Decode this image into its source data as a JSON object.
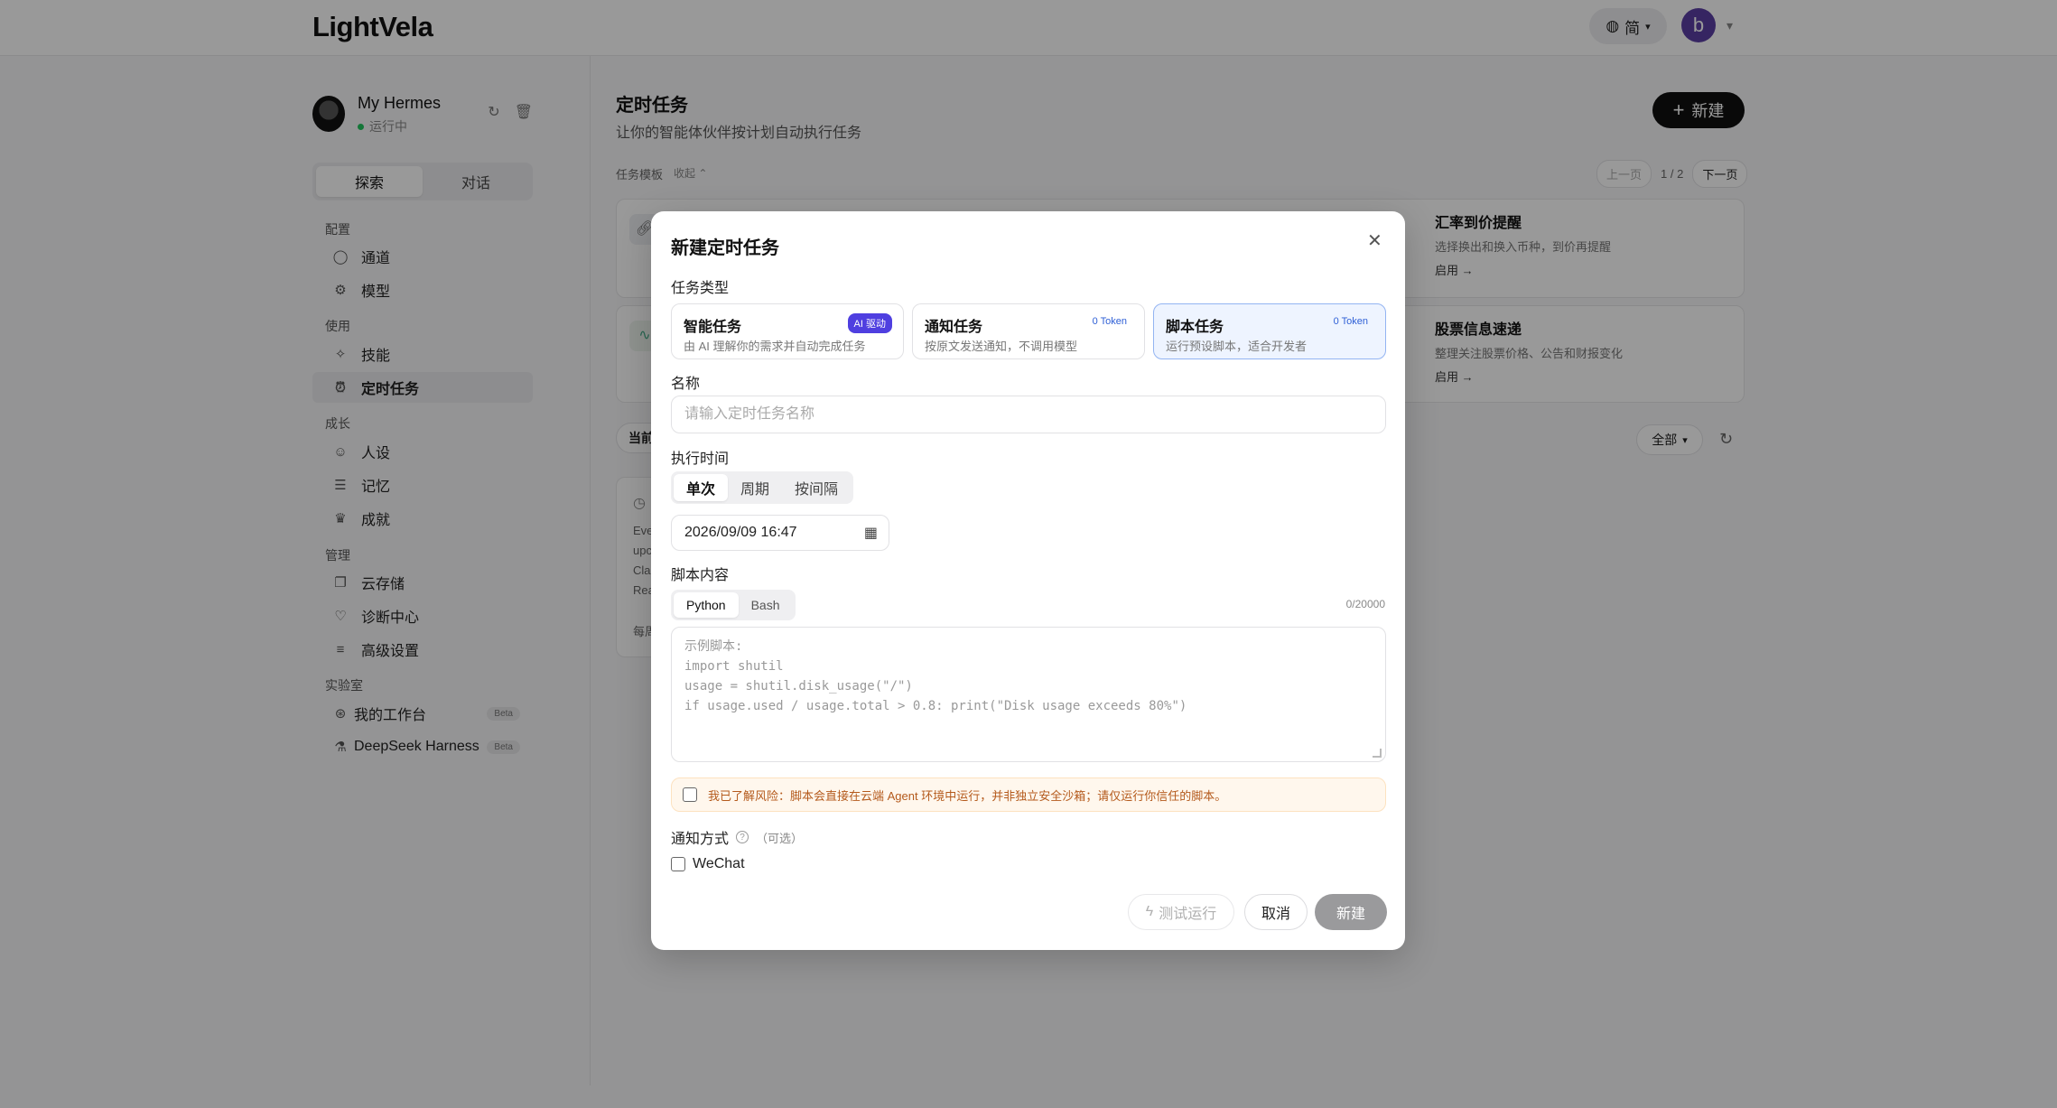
{
  "app": {
    "logo": "LightVela"
  },
  "header": {
    "lang": "简",
    "avatar_letter": "b"
  },
  "agent": {
    "name": "My Hermes",
    "status": "运行中"
  },
  "sidebar": {
    "tabs": [
      "探索",
      "对话"
    ],
    "sections": {
      "config": "配置",
      "use": "使用",
      "grow": "成长",
      "manage": "管理",
      "lab": "实验室"
    },
    "items": {
      "channel": "通道",
      "model": "模型",
      "skill": "技能",
      "scheduled": "定时任务",
      "persona": "人设",
      "memory": "记忆",
      "achievement": "成就",
      "storage": "云存储",
      "diagnosis": "诊断中心",
      "advanced": "高级设置",
      "workbench": "我的工作台",
      "deepseek": "DeepSeek Harness"
    },
    "beta": "Beta"
  },
  "main": {
    "title": "定时任务",
    "subtitle": "让你的智能体伙伴按计划自动执行任务",
    "new_button": "新建",
    "templates_label": "任务模板",
    "collapse": "收起",
    "pager": {
      "prev": "上一页",
      "page": "1 / 2",
      "next": "下一页"
    },
    "template_cards": [
      {
        "title": "汇率到价提醒",
        "desc": "选择换出和换入币种，到价再提醒",
        "action": "启用 →"
      },
      {
        "title": "股票信息速递",
        "desc": "整理关注股票价格、公告和财报变化",
        "action": "启用 →"
      }
    ],
    "current_tab_partial": "当前",
    "filter": "全部",
    "task_card_partial": [
      "Eve",
      "upc",
      "Cla",
      "Rea"
    ],
    "task_card_footer_partial": "每周"
  },
  "modal": {
    "title": "新建定时任务",
    "type_label": "任务类型",
    "types": [
      {
        "name": "智能任务",
        "desc": "由 AI 理解你的需求并自动完成任务",
        "badge": "AI 驱动"
      },
      {
        "name": "通知任务",
        "desc": "按原文发送通知，不调用模型",
        "badge": "0 Token"
      },
      {
        "name": "脚本任务",
        "desc": "运行预设脚本，适合开发者",
        "badge": "0 Token"
      }
    ],
    "name_label": "名称",
    "name_placeholder": "请输入定时任务名称",
    "time_label": "执行时间",
    "time_modes": [
      "单次",
      "周期",
      "按间隔"
    ],
    "datetime": "2026/09/09 16:47",
    "script_label": "脚本内容",
    "script_langs": [
      "Python",
      "Bash"
    ],
    "char_count": "0/20000",
    "script_placeholder": [
      "示例脚本:",
      "import shutil",
      "usage = shutil.disk_usage(\"/\")",
      "if usage.used / usage.total > 0.8: print(\"Disk usage exceeds 80%\")"
    ],
    "risk_notice": "我已了解风险：脚本会直接在云端 Agent 环境中运行，并非独立安全沙箱；请仅运行你信任的脚本。",
    "notify_label": "通知方式",
    "notify_optional": "（可选）",
    "notify_wechat": "WeChat",
    "buttons": {
      "test": "测试运行",
      "cancel": "取消",
      "create": "新建"
    }
  },
  "colors": {
    "accent_ai": "#4f3fe0",
    "token_blue": "#2e5fd6",
    "warn_text": "#b45a1c",
    "active_card_border": "#93b4f2"
  }
}
